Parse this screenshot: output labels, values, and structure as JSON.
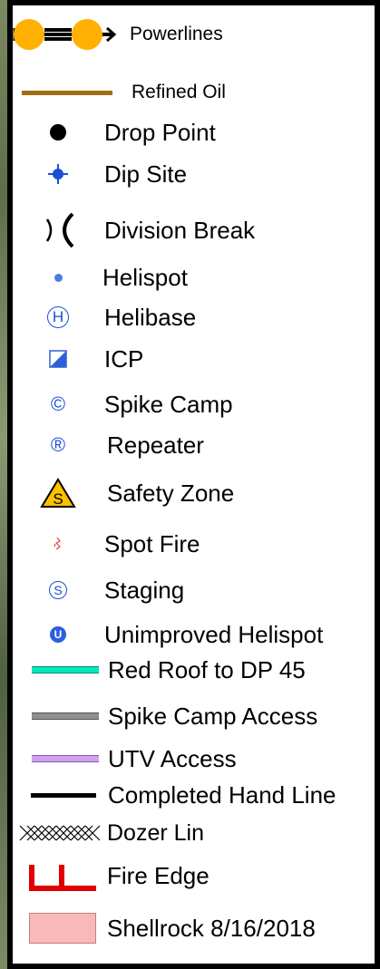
{
  "legend": {
    "items": [
      {
        "label": "Powerlines",
        "icon": "powerline-icon",
        "color": "#ffb000"
      },
      {
        "label": "Refined Oil",
        "icon": "brown-line-icon",
        "color": "#a07010"
      },
      {
        "label": "Drop Point",
        "icon": "black-dot-icon",
        "color": "#000000"
      },
      {
        "label": "Dip Site",
        "icon": "dip-site-icon",
        "color": "#1a4fd6"
      },
      {
        "label": "Division Break",
        "icon": "division-break-icon",
        "color": "#000000"
      },
      {
        "label": "Helispot",
        "icon": "blue-dot-icon",
        "color": "#4a7fe0"
      },
      {
        "label": "Helibase",
        "icon": "helibase-icon",
        "color": "#1a4fd6",
        "symbol": "H"
      },
      {
        "label": "ICP",
        "icon": "icp-icon",
        "color": "#3060d8"
      },
      {
        "label": "Spike Camp",
        "icon": "spike-camp-icon",
        "color": "#1a4fd6",
        "symbol": "©"
      },
      {
        "label": "Repeater",
        "icon": "repeater-icon",
        "color": "#1a4fd6",
        "symbol": "®"
      },
      {
        "label": "Safety Zone",
        "icon": "safety-zone-icon",
        "color": "#ffc000",
        "symbol": "S"
      },
      {
        "label": "Spot Fire",
        "icon": "spot-fire-icon",
        "color": "#e04040"
      },
      {
        "label": "Staging",
        "icon": "staging-icon",
        "color": "#1a4fd6",
        "symbol": "S"
      },
      {
        "label": "Unimproved Helispot",
        "icon": "unimproved-helispot-icon",
        "color": "#2a5fe0",
        "symbol": "U"
      },
      {
        "label": "Red Roof to DP 45",
        "icon": "teal-line-icon",
        "color": "#00e8c0"
      },
      {
        "label": "Spike Camp Access",
        "icon": "gray-line-icon",
        "color": "#909090"
      },
      {
        "label": "UTV Access",
        "icon": "lavender-line-icon",
        "color": "#d0a0f0"
      },
      {
        "label": "Completed Hand Line",
        "icon": "black-line-icon",
        "color": "#000000"
      },
      {
        "label": "Dozer Lin",
        "icon": "dozer-line-icon",
        "color": "#000000"
      },
      {
        "label": "Fire Edge",
        "icon": "fire-edge-icon",
        "color": "#e00000"
      },
      {
        "label": "Shellrock 8/16/2018",
        "icon": "perimeter-fill-icon",
        "color": "#f9b9b9"
      }
    ]
  }
}
